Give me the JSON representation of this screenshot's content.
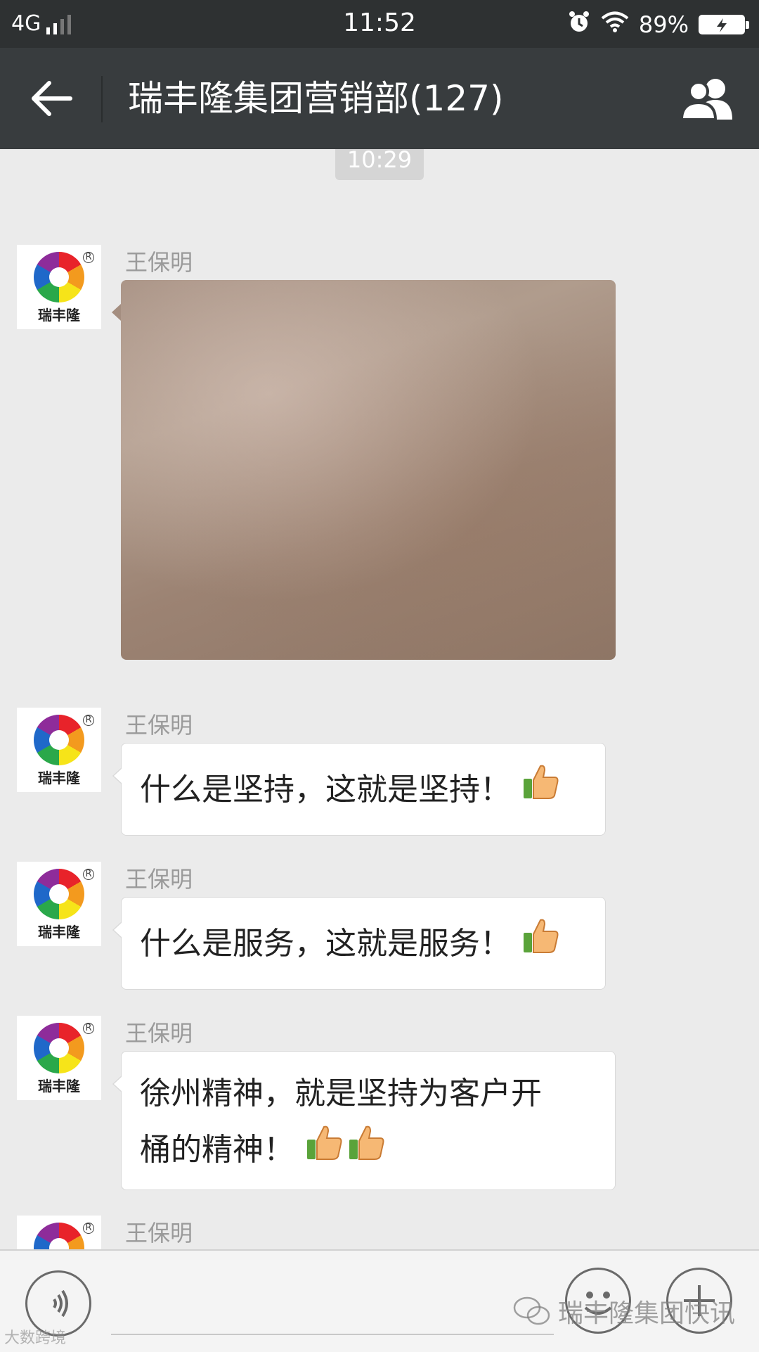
{
  "status_bar": {
    "network": "4G",
    "time": "11:52",
    "battery": "89%",
    "icons": [
      "signal-icon",
      "alarm-icon",
      "wifi-icon",
      "battery-charging-icon"
    ]
  },
  "header": {
    "title": "瑞丰隆集团营销部(127)",
    "icons": [
      "back-arrow-icon",
      "group-members-icon"
    ]
  },
  "chat": {
    "timestamp": "10:29",
    "messages": [
      {
        "sender": "王保明",
        "avatar_text": "瑞丰隆",
        "type": "image"
      },
      {
        "sender": "王保明",
        "avatar_text": "瑞丰隆",
        "type": "text",
        "line1": "什么是坚持，这就是坚持！",
        "emoji": "thumbs-up"
      },
      {
        "sender": "王保明",
        "avatar_text": "瑞丰隆",
        "type": "text",
        "line1": "什么是服务，这就是服务！",
        "emoji": "thumbs-up"
      },
      {
        "sender": "王保明",
        "avatar_text": "瑞丰隆",
        "type": "text",
        "line1": "徐州精神，就是坚持为客户开",
        "line2": "桶的精神！",
        "emoji": "thumbs-up x2"
      },
      {
        "sender": "王保明",
        "avatar_text": "瑞丰隆",
        "type": "partial"
      }
    ]
  },
  "input_bar": {
    "icons": [
      "voice-icon",
      "emoji-icon",
      "plus-icon"
    ]
  },
  "watermark": {
    "text": "瑞丰隆集团快讯",
    "corner": "大数跨境"
  },
  "colors": {
    "status_bar": "#2e3132",
    "title_bar": "#383c3e",
    "chat_bg": "#ebebeb",
    "bubble": "#ffffff"
  }
}
